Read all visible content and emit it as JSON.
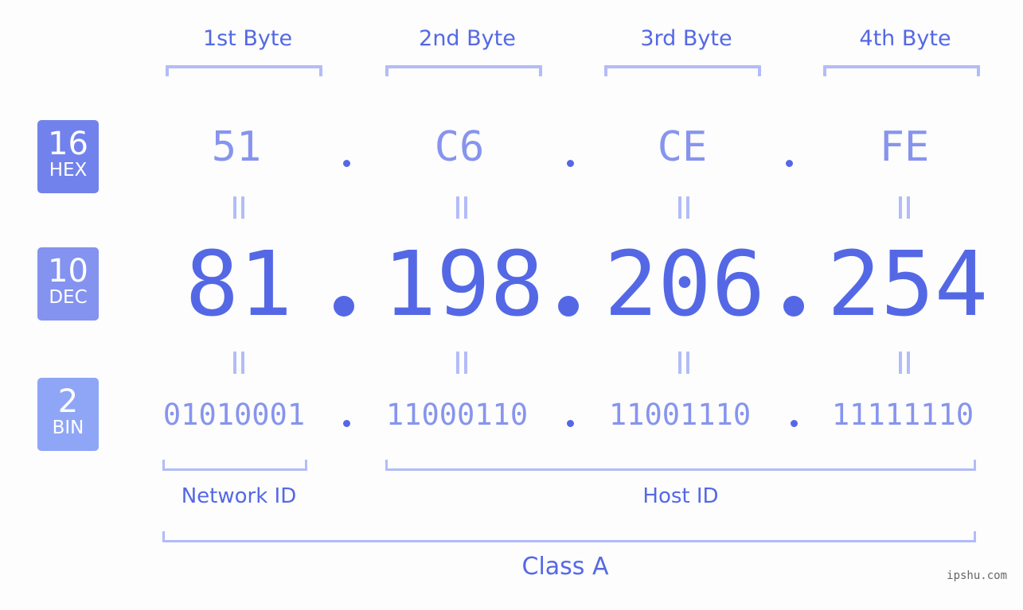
{
  "bytes": [
    {
      "label": "1st Byte",
      "hex": "51",
      "dec": "81",
      "bin": "01010001"
    },
    {
      "label": "2nd Byte",
      "hex": "C6",
      "dec": "198",
      "bin": "11000110"
    },
    {
      "label": "3rd Byte",
      "hex": "CE",
      "dec": "206",
      "bin": "11001110"
    },
    {
      "label": "4th Byte",
      "hex": "FE",
      "dec": "254",
      "bin": "11111110"
    }
  ],
  "badges": {
    "hex": {
      "num": "16",
      "label": "HEX",
      "color": "#7282ec"
    },
    "dec": {
      "num": "10",
      "label": "DEC",
      "color": "#8492f0"
    },
    "bin": {
      "num": "2",
      "label": "BIN",
      "color": "#8fa6f6"
    }
  },
  "network_label": "Network ID",
  "host_label": "Host ID",
  "class_label": "Class A",
  "watermark": "ipshu.com",
  "colors": {
    "primary": "#5468e6",
    "secondary": "#8794ee",
    "bracket": "#b3bcf8"
  }
}
